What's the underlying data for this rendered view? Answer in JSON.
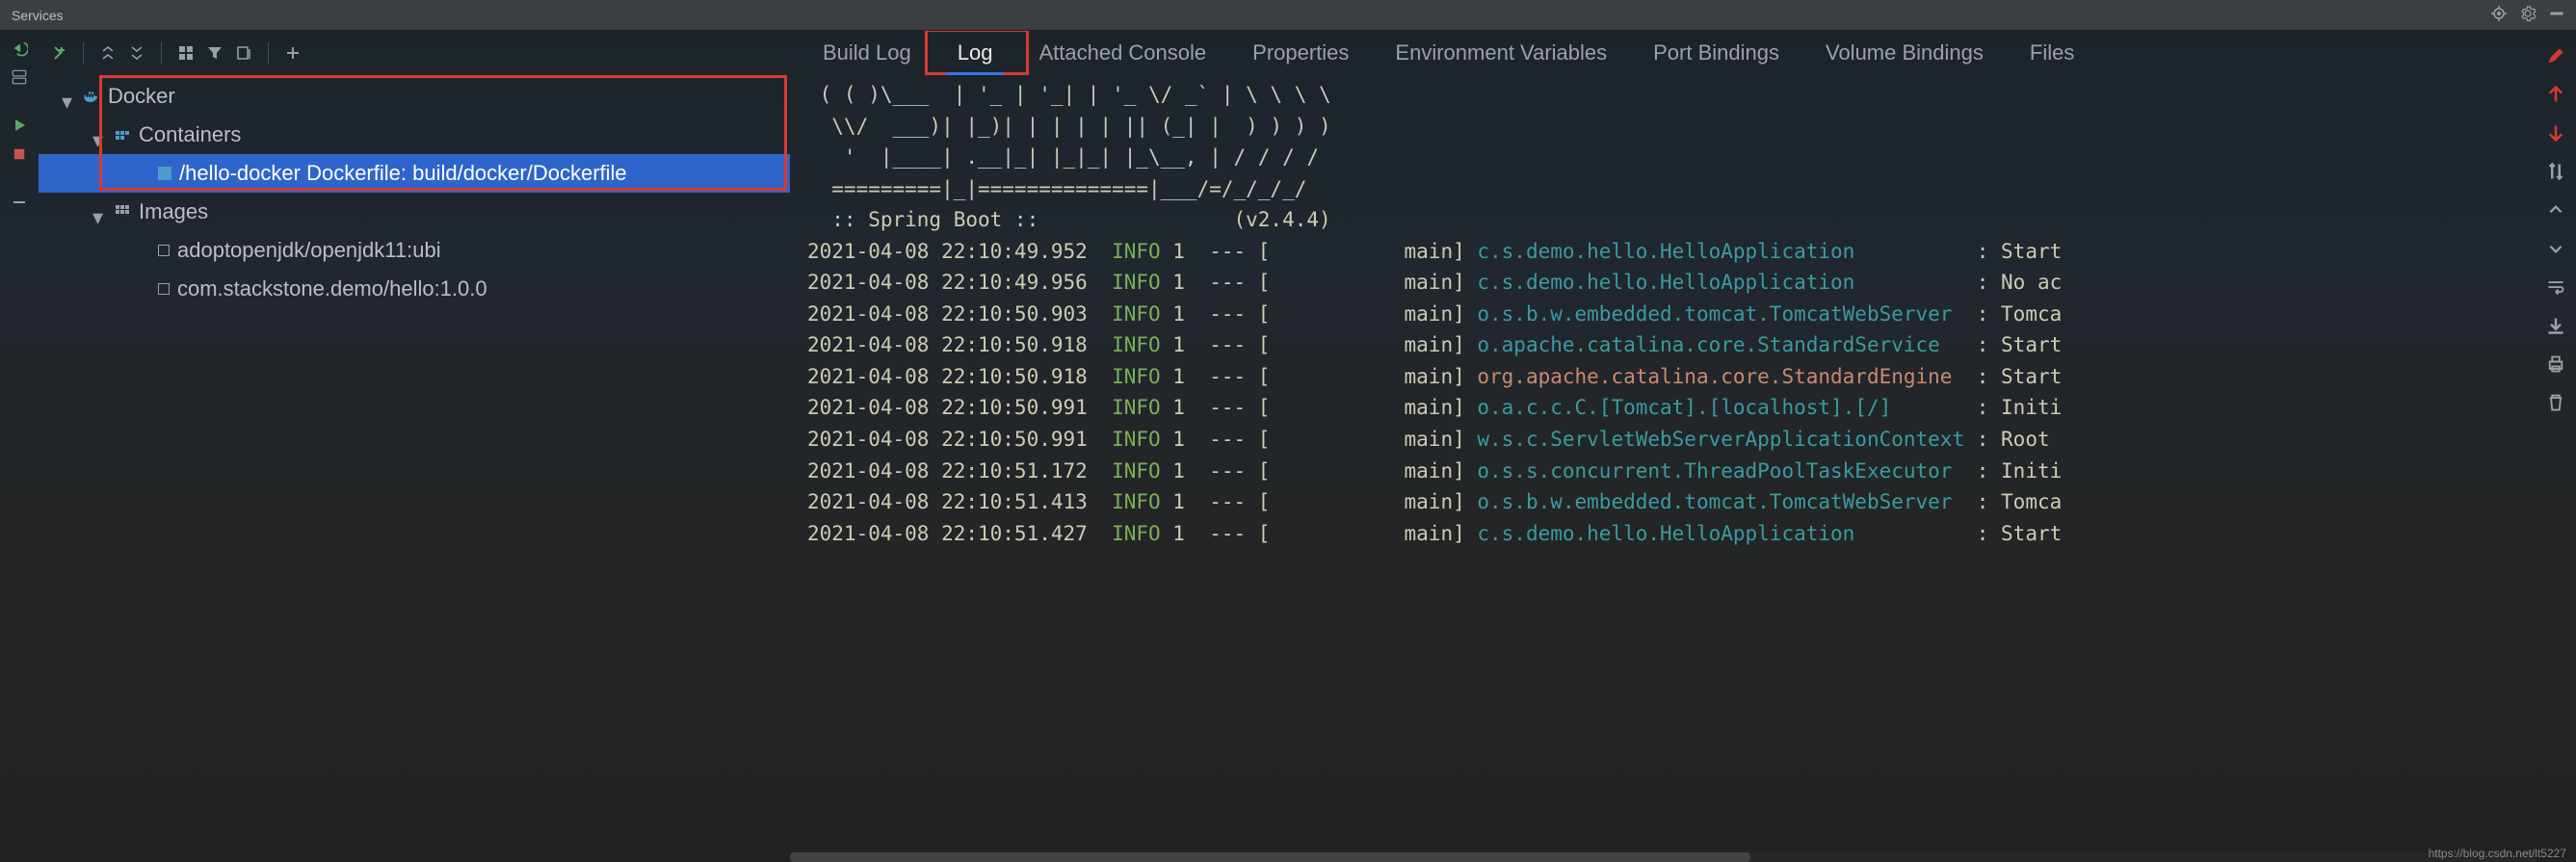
{
  "window": {
    "title": "Services"
  },
  "toolbar_icons": [
    "add-run",
    "expand-all",
    "collapse-all",
    "thumbnails",
    "filter",
    "groupby",
    "plus"
  ],
  "tree": {
    "docker": {
      "label": "Docker"
    },
    "containers": {
      "label": "Containers"
    },
    "container_item": {
      "label": "/hello-docker Dockerfile: build/docker/Dockerfile"
    },
    "images": {
      "label": "Images"
    },
    "image_items": [
      {
        "label": "adoptopenjdk/openjdk11:ubi"
      },
      {
        "label": "com.stackstone.demo/hello:1.0.0"
      }
    ]
  },
  "tabs": [
    {
      "id": "build-log",
      "label": "Build Log",
      "active": false
    },
    {
      "id": "log",
      "label": "Log",
      "active": true
    },
    {
      "id": "attached-console",
      "label": "Attached Console",
      "active": false
    },
    {
      "id": "properties",
      "label": "Properties",
      "active": false
    },
    {
      "id": "env-vars",
      "label": "Environment Variables",
      "active": false
    },
    {
      "id": "port-bindings",
      "label": "Port Bindings",
      "active": false
    },
    {
      "id": "volume-bindings",
      "label": "Volume Bindings",
      "active": false
    },
    {
      "id": "files",
      "label": "Files",
      "active": false
    }
  ],
  "log": {
    "banner": [
      " ( ( )\\___  | '_ | '_| | '_ \\/ _` | \\ \\ \\ \\",
      "  \\\\/  ___)| |_)| | | | | || (_| |  ) ) ) )",
      "   '  |____| .__|_| |_|_| |_\\__, | / / / /",
      "  =========|_|==============|___/=/_/_/_/",
      "  :: Spring Boot ::                (v2.4.4)",
      ""
    ],
    "entries": [
      {
        "ts": "2021-04-08 22:10:49.952",
        "level": "INFO",
        "pid": "1",
        "sep": "--- [",
        "thread": "main]",
        "class": "c.s.demo.hello.HelloApplication",
        "classStyle": "a",
        "msg": "Start"
      },
      {
        "ts": "2021-04-08 22:10:49.956",
        "level": "INFO",
        "pid": "1",
        "sep": "--- [",
        "thread": "main]",
        "class": "c.s.demo.hello.HelloApplication",
        "classStyle": "a",
        "msg": "No ac"
      },
      {
        "ts": "2021-04-08 22:10:50.903",
        "level": "INFO",
        "pid": "1",
        "sep": "--- [",
        "thread": "main]",
        "class": "o.s.b.w.embedded.tomcat.TomcatWebServer",
        "classStyle": "a",
        "msg": "Tomca"
      },
      {
        "ts": "2021-04-08 22:10:50.918",
        "level": "INFO",
        "pid": "1",
        "sep": "--- [",
        "thread": "main]",
        "class": "o.apache.catalina.core.StandardService",
        "classStyle": "a",
        "msg": "Start"
      },
      {
        "ts": "2021-04-08 22:10:50.918",
        "level": "INFO",
        "pid": "1",
        "sep": "--- [",
        "thread": "main]",
        "class": "org.apache.catalina.core.StandardEngine",
        "classStyle": "b",
        "msg": "Start"
      },
      {
        "ts": "2021-04-08 22:10:50.991",
        "level": "INFO",
        "pid": "1",
        "sep": "--- [",
        "thread": "main]",
        "class": "o.a.c.c.C.[Tomcat].[localhost].[/]",
        "classStyle": "a",
        "msg": "Initi"
      },
      {
        "ts": "2021-04-08 22:10:50.991",
        "level": "INFO",
        "pid": "1",
        "sep": "--- [",
        "thread": "main]",
        "class": "w.s.c.ServletWebServerApplicationContext",
        "classStyle": "a",
        "msg": "Root "
      },
      {
        "ts": "2021-04-08 22:10:51.172",
        "level": "INFO",
        "pid": "1",
        "sep": "--- [",
        "thread": "main]",
        "class": "o.s.s.concurrent.ThreadPoolTaskExecutor",
        "classStyle": "a",
        "msg": "Initi"
      },
      {
        "ts": "2021-04-08 22:10:51.413",
        "level": "INFO",
        "pid": "1",
        "sep": "--- [",
        "thread": "main]",
        "class": "o.s.b.w.embedded.tomcat.TomcatWebServer",
        "classStyle": "a",
        "msg": "Tomca"
      },
      {
        "ts": "2021-04-08 22:10:51.427",
        "level": "INFO",
        "pid": "1",
        "sep": "--- [",
        "thread": "main]",
        "class": "c.s.demo.hello.HelloApplication",
        "classStyle": "a",
        "msg": "Start"
      }
    ]
  },
  "watermark": "https://blog.csdn.net/lt5227",
  "colors": {
    "accent": "#3574f0",
    "selection": "#2f65ca",
    "highlight_red": "#d73a31",
    "log_info": "#7ab05a",
    "class_a": "#3b9b9f",
    "class_b": "#c98b6f"
  }
}
